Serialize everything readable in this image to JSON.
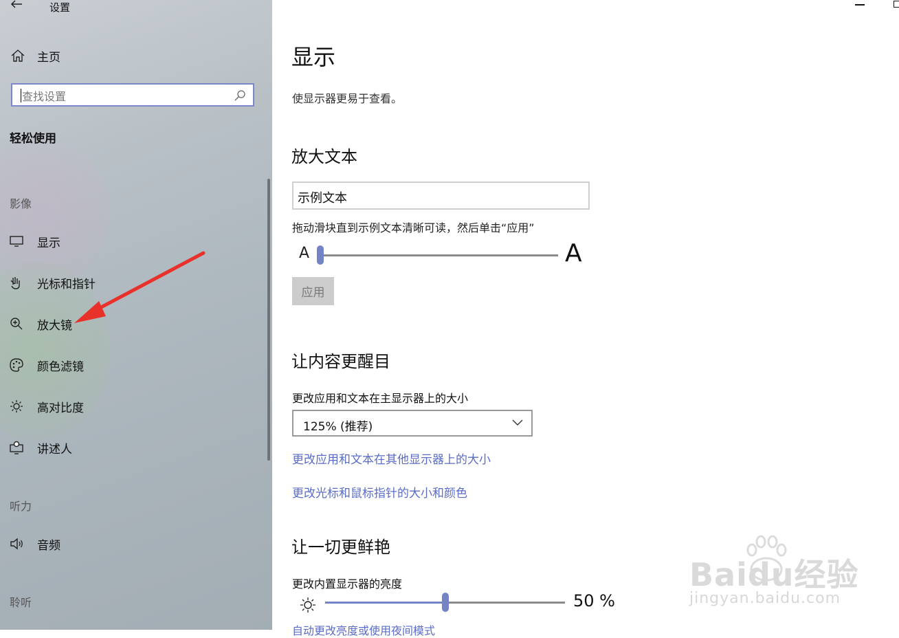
{
  "window": {
    "title": "设置"
  },
  "sidebar": {
    "home_label": "主页",
    "search_placeholder": "查找设置",
    "section_title": "轻松使用",
    "groups": [
      {
        "label": "影像"
      },
      {
        "label": "听力"
      },
      {
        "label": "聆听"
      }
    ],
    "items": [
      {
        "label": "显示",
        "icon": "monitor-icon"
      },
      {
        "label": "光标和指针",
        "icon": "cursor-hand-icon"
      },
      {
        "label": "放大镜",
        "icon": "magnifier-icon"
      },
      {
        "label": "颜色滤镜",
        "icon": "palette-icon"
      },
      {
        "label": "高对比度",
        "icon": "sun-icon"
      },
      {
        "label": "讲述人",
        "icon": "narrator-icon"
      },
      {
        "label": "音频",
        "icon": "speaker-icon"
      }
    ]
  },
  "main": {
    "title": "显示",
    "description": "使显示器更易于查看。",
    "enlarge_text": {
      "heading": "放大文本",
      "sample_text": "示例文本",
      "hint": "拖动滑块直到示例文本清晰可读，然后单击“应用”",
      "small_a": "A",
      "big_a": "A",
      "slider_value": 0,
      "apply_label": "应用"
    },
    "stand_out": {
      "heading": "让内容更醒目",
      "scale_label": "更改应用和文本在主显示器上的大小",
      "scale_value": "125% (推荐)",
      "link_other_displays": "更改应用和文本在其他显示器上的大小",
      "link_cursor": "更改光标和鼠标指针的大小和颜色"
    },
    "brighter": {
      "heading": "让一切更鲜艳",
      "brightness_label": "更改内置显示器的亮度",
      "brightness_value": 50,
      "brightness_text": "50 %",
      "partial_link": "自动更改亮度或使用夜间模式"
    }
  },
  "watermark": {
    "brand": "Baidu经验",
    "url": "jingyan.baidu.com"
  },
  "colors": {
    "accent": "#7383c4",
    "link": "#5a6cc7",
    "arrow": "#e8312a"
  }
}
